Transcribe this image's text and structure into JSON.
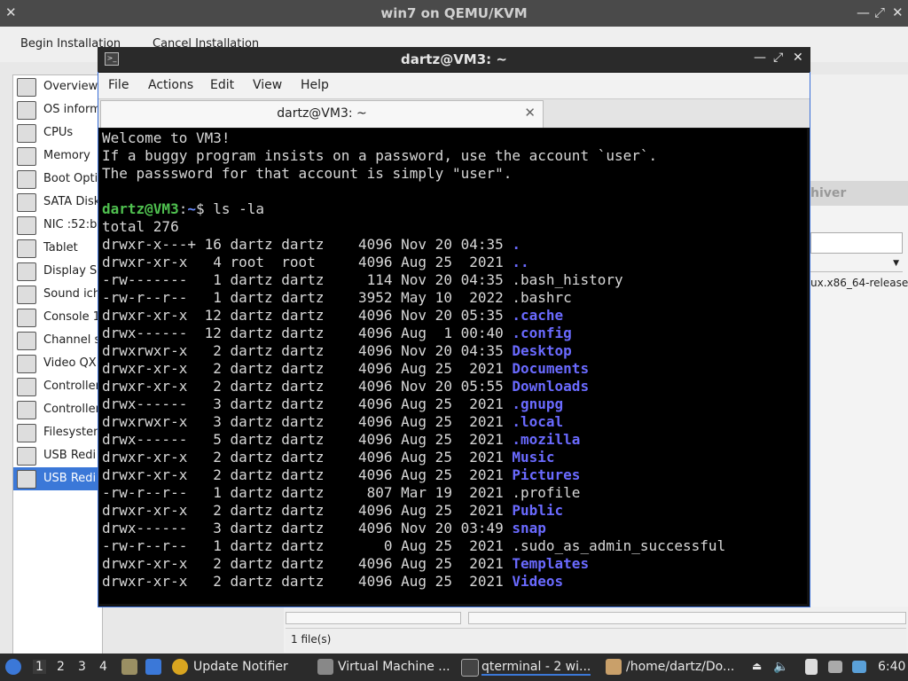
{
  "vm_window": {
    "title": "win7 on QEMU/KVM",
    "menu": [
      "Begin Installation",
      "Cancel Installation"
    ],
    "sidebar_items": [
      {
        "label": "Overview",
        "icon": "monitor-icon"
      },
      {
        "label": "OS inform",
        "icon": "monitor-icon"
      },
      {
        "label": "CPUs",
        "icon": "cpu-icon"
      },
      {
        "label": "Memory",
        "icon": "memory-icon"
      },
      {
        "label": "Boot Opti",
        "icon": "gear-icon"
      },
      {
        "label": "SATA Disk",
        "icon": "disk-icon"
      },
      {
        "label": "NIC :52:b",
        "icon": "network-icon"
      },
      {
        "label": "Tablet",
        "icon": "tablet-icon"
      },
      {
        "label": "Display S",
        "icon": "display-icon"
      },
      {
        "label": "Sound ich",
        "icon": "sound-icon"
      },
      {
        "label": "Console 1",
        "icon": "console-icon"
      },
      {
        "label": "Channel s",
        "icon": "channel-icon"
      },
      {
        "label": "Video QX",
        "icon": "video-icon"
      },
      {
        "label": "Controller",
        "icon": "controller-icon"
      },
      {
        "label": "Controller",
        "icon": "controller-icon"
      },
      {
        "label": "Filesystem",
        "icon": "folder-icon"
      },
      {
        "label": "USB Redi",
        "icon": "usb-icon"
      },
      {
        "label": "USB Redi",
        "icon": "usb-icon"
      }
    ],
    "selected_index": 17
  },
  "archiver": {
    "title_fragment": "hiver",
    "file_fragment": "ux.x86_64-release",
    "status": "1 file(s)"
  },
  "terminal": {
    "title": "dartz@VM3: ~",
    "menu": [
      "File",
      "Actions",
      "Edit",
      "View",
      "Help"
    ],
    "tab_label": "dartz@VM3: ~",
    "welcome": [
      "Welcome to VM3!",
      "If a buggy program insists on a password, use the account `user`.",
      "The passsword for that account is simply \"user\"."
    ],
    "prompt_user": "dartz@VM3",
    "prompt_sep": ":",
    "prompt_path": "~",
    "command": "$ ls -la",
    "total": "total 276",
    "entries": [
      {
        "perm": "drwxr-x---+",
        "links": "16",
        "owner": "dartz",
        "group": "dartz",
        "size": "4096",
        "date": "Nov 20 04:35",
        "name": ".",
        "dir": true
      },
      {
        "perm": "drwxr-xr-x",
        "links": "4",
        "owner": "root",
        "group": "root",
        "size": "4096",
        "date": "Aug 25  2021",
        "name": "..",
        "dir": true
      },
      {
        "perm": "-rw-------",
        "links": "1",
        "owner": "dartz",
        "group": "dartz",
        "size": "114",
        "date": "Nov 20 04:35",
        "name": ".bash_history",
        "dir": false
      },
      {
        "perm": "-rw-r--r--",
        "links": "1",
        "owner": "dartz",
        "group": "dartz",
        "size": "3952",
        "date": "May 10  2022",
        "name": ".bashrc",
        "dir": false
      },
      {
        "perm": "drwxr-xr-x",
        "links": "12",
        "owner": "dartz",
        "group": "dartz",
        "size": "4096",
        "date": "Nov 20 05:35",
        "name": ".cache",
        "dir": true
      },
      {
        "perm": "drwx------",
        "links": "12",
        "owner": "dartz",
        "group": "dartz",
        "size": "4096",
        "date": "Aug  1 00:40",
        "name": ".config",
        "dir": true
      },
      {
        "perm": "drwxrwxr-x",
        "links": "2",
        "owner": "dartz",
        "group": "dartz",
        "size": "4096",
        "date": "Nov 20 04:35",
        "name": "Desktop",
        "dir": true
      },
      {
        "perm": "drwxr-xr-x",
        "links": "2",
        "owner": "dartz",
        "group": "dartz",
        "size": "4096",
        "date": "Aug 25  2021",
        "name": "Documents",
        "dir": true
      },
      {
        "perm": "drwxr-xr-x",
        "links": "2",
        "owner": "dartz",
        "group": "dartz",
        "size": "4096",
        "date": "Nov 20 05:55",
        "name": "Downloads",
        "dir": true
      },
      {
        "perm": "drwx------",
        "links": "3",
        "owner": "dartz",
        "group": "dartz",
        "size": "4096",
        "date": "Aug 25  2021",
        "name": ".gnupg",
        "dir": true
      },
      {
        "perm": "drwxrwxr-x",
        "links": "3",
        "owner": "dartz",
        "group": "dartz",
        "size": "4096",
        "date": "Aug 25  2021",
        "name": ".local",
        "dir": true
      },
      {
        "perm": "drwx------",
        "links": "5",
        "owner": "dartz",
        "group": "dartz",
        "size": "4096",
        "date": "Aug 25  2021",
        "name": ".mozilla",
        "dir": true
      },
      {
        "perm": "drwxr-xr-x",
        "links": "2",
        "owner": "dartz",
        "group": "dartz",
        "size": "4096",
        "date": "Aug 25  2021",
        "name": "Music",
        "dir": true
      },
      {
        "perm": "drwxr-xr-x",
        "links": "2",
        "owner": "dartz",
        "group": "dartz",
        "size": "4096",
        "date": "Aug 25  2021",
        "name": "Pictures",
        "dir": true
      },
      {
        "perm": "-rw-r--r--",
        "links": "1",
        "owner": "dartz",
        "group": "dartz",
        "size": "807",
        "date": "Mar 19  2021",
        "name": ".profile",
        "dir": false
      },
      {
        "perm": "drwxr-xr-x",
        "links": "2",
        "owner": "dartz",
        "group": "dartz",
        "size": "4096",
        "date": "Aug 25  2021",
        "name": "Public",
        "dir": true
      },
      {
        "perm": "drwx------",
        "links": "3",
        "owner": "dartz",
        "group": "dartz",
        "size": "4096",
        "date": "Nov 20 03:49",
        "name": "snap",
        "dir": true
      },
      {
        "perm": "-rw-r--r--",
        "links": "1",
        "owner": "dartz",
        "group": "dartz",
        "size": "0",
        "date": "Aug 25  2021",
        "name": ".sudo_as_admin_successful",
        "dir": false
      },
      {
        "perm": "drwxr-xr-x",
        "links": "2",
        "owner": "dartz",
        "group": "dartz",
        "size": "4096",
        "date": "Aug 25  2021",
        "name": "Templates",
        "dir": true
      },
      {
        "perm": "drwxr-xr-x",
        "links": "2",
        "owner": "dartz",
        "group": "dartz",
        "size": "4096",
        "date": "Aug 25  2021",
        "name": "Videos",
        "dir": true
      }
    ]
  },
  "taskbar": {
    "workspaces": [
      "1",
      "2",
      "3",
      "4"
    ],
    "tasks": [
      "Update Notifier",
      "Virtual Machine ...",
      "qterminal - 2 wi...",
      "/home/dartz/Do..."
    ],
    "clock": "6:40"
  },
  "colors": {
    "accent": "#3b78d8",
    "prompt_user": "#4fc04f",
    "dir": "#6a6aff"
  }
}
